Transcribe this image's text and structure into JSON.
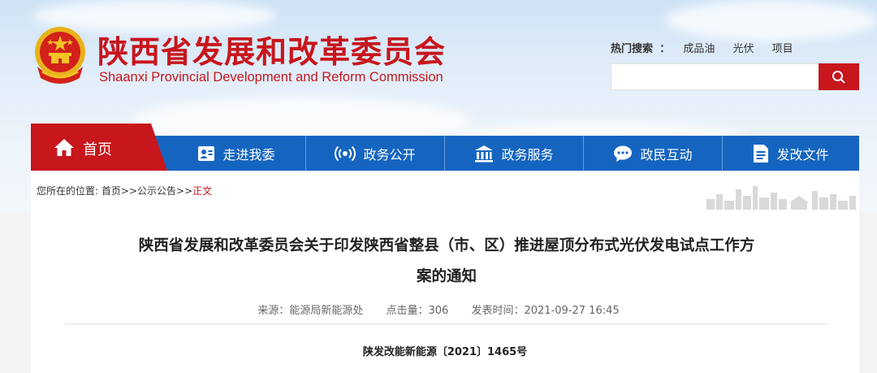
{
  "header": {
    "title": "陕西省发展和改革委员会",
    "subtitle": "Shaanxi Provincial Development and Reform Commission",
    "hot_search_label": "热门搜索",
    "hot_search_sep": "：",
    "hot_search_items": [
      "成品油",
      "光伏",
      "项目"
    ],
    "search_placeholder": ""
  },
  "nav": {
    "home": "首页",
    "items": [
      {
        "label": "走进我委",
        "icon": "person-card-icon"
      },
      {
        "label": "政务公开",
        "icon": "broadcast-icon"
      },
      {
        "label": "政务服务",
        "icon": "building-icon"
      },
      {
        "label": "政民互动",
        "icon": "chat-icon"
      },
      {
        "label": "发改文件",
        "icon": "document-icon"
      }
    ]
  },
  "breadcrumb": {
    "prefix": "您所在的位置:",
    "home": "首页",
    "sep1": ">>",
    "section": "公示公告",
    "sep2": ">>",
    "current": "正文"
  },
  "article": {
    "title_line1": "陕西省发展和改革委员会关于印发陕西省整县（市、区）推进屋顶分布式光伏发电试点工作方",
    "title_line2": "案的通知",
    "source": "来源：能源局新能源处",
    "clicks": "点击量：306",
    "published": "发表时间：2021-09-27 16:45",
    "doc_number": "陕发改能新能源〔2021〕1465号"
  },
  "colors": {
    "brand_red": "#c8161d",
    "nav_blue": "#1565c0"
  }
}
